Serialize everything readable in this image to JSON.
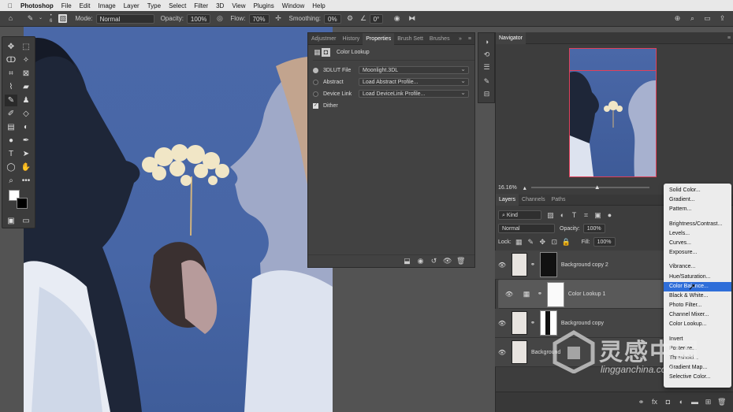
{
  "menubar": {
    "app": "Photoshop",
    "items": [
      "File",
      "Edit",
      "Image",
      "Layer",
      "Type",
      "Select",
      "Filter",
      "3D",
      "View",
      "Plugins",
      "Window",
      "Help"
    ]
  },
  "options": {
    "mode_label": "Mode:",
    "mode_value": "Normal",
    "opacity_label": "Opacity:",
    "opacity_value": "100%",
    "flow_label": "Flow:",
    "flow_value": "70%",
    "smoothing_label": "Smoothing:",
    "smoothing_value": "0%",
    "angle_value": "0°",
    "brush_size": "6"
  },
  "properties": {
    "tabs": [
      "Adjustmer",
      "History",
      "Properties",
      "Brush Sett",
      "Brushes"
    ],
    "active_tab": "Properties",
    "title": "Color Lookup",
    "rows": [
      {
        "label": "3DLUT File",
        "value": "Moonlight.3DL"
      },
      {
        "label": "Abstract",
        "value": "Load Abstract Profile..."
      },
      {
        "label": "Device Link",
        "value": "Load DeviceLink Profile..."
      }
    ],
    "dither_label": "Dither"
  },
  "navigator": {
    "title": "Navigator",
    "zoom": "16.16%"
  },
  "layers": {
    "tabs": [
      "Layers",
      "Channels",
      "Paths"
    ],
    "kind_label": "Kind",
    "blend_mode": "Normal",
    "opacity_label": "Opacity:",
    "opacity_value": "100%",
    "lock_label": "Lock:",
    "fill_label": "Fill:",
    "fill_value": "100%",
    "items": [
      {
        "name": "Background copy 2"
      },
      {
        "name": "Color Lookup 1"
      },
      {
        "name": "Background copy"
      },
      {
        "name": "Background"
      }
    ]
  },
  "adjust_menu": {
    "items": [
      "Solid Color...",
      "Gradient...",
      "Pattern...",
      "Brightness/Contrast...",
      "Levels...",
      "Curves...",
      "Exposure...",
      "Vibrance...",
      "Hue/Saturation...",
      "Color Balance...",
      "Black & White...",
      "Photo Filter...",
      "Channel Mixer...",
      "Color Lookup...",
      "Invert",
      "Posterize...",
      "Threshold...",
      "Gradient Map...",
      "Selective Color..."
    ],
    "highlighted": "Color Balance..."
  },
  "watermark": {
    "text": "灵感中国",
    "url": "lingganchina.com"
  }
}
